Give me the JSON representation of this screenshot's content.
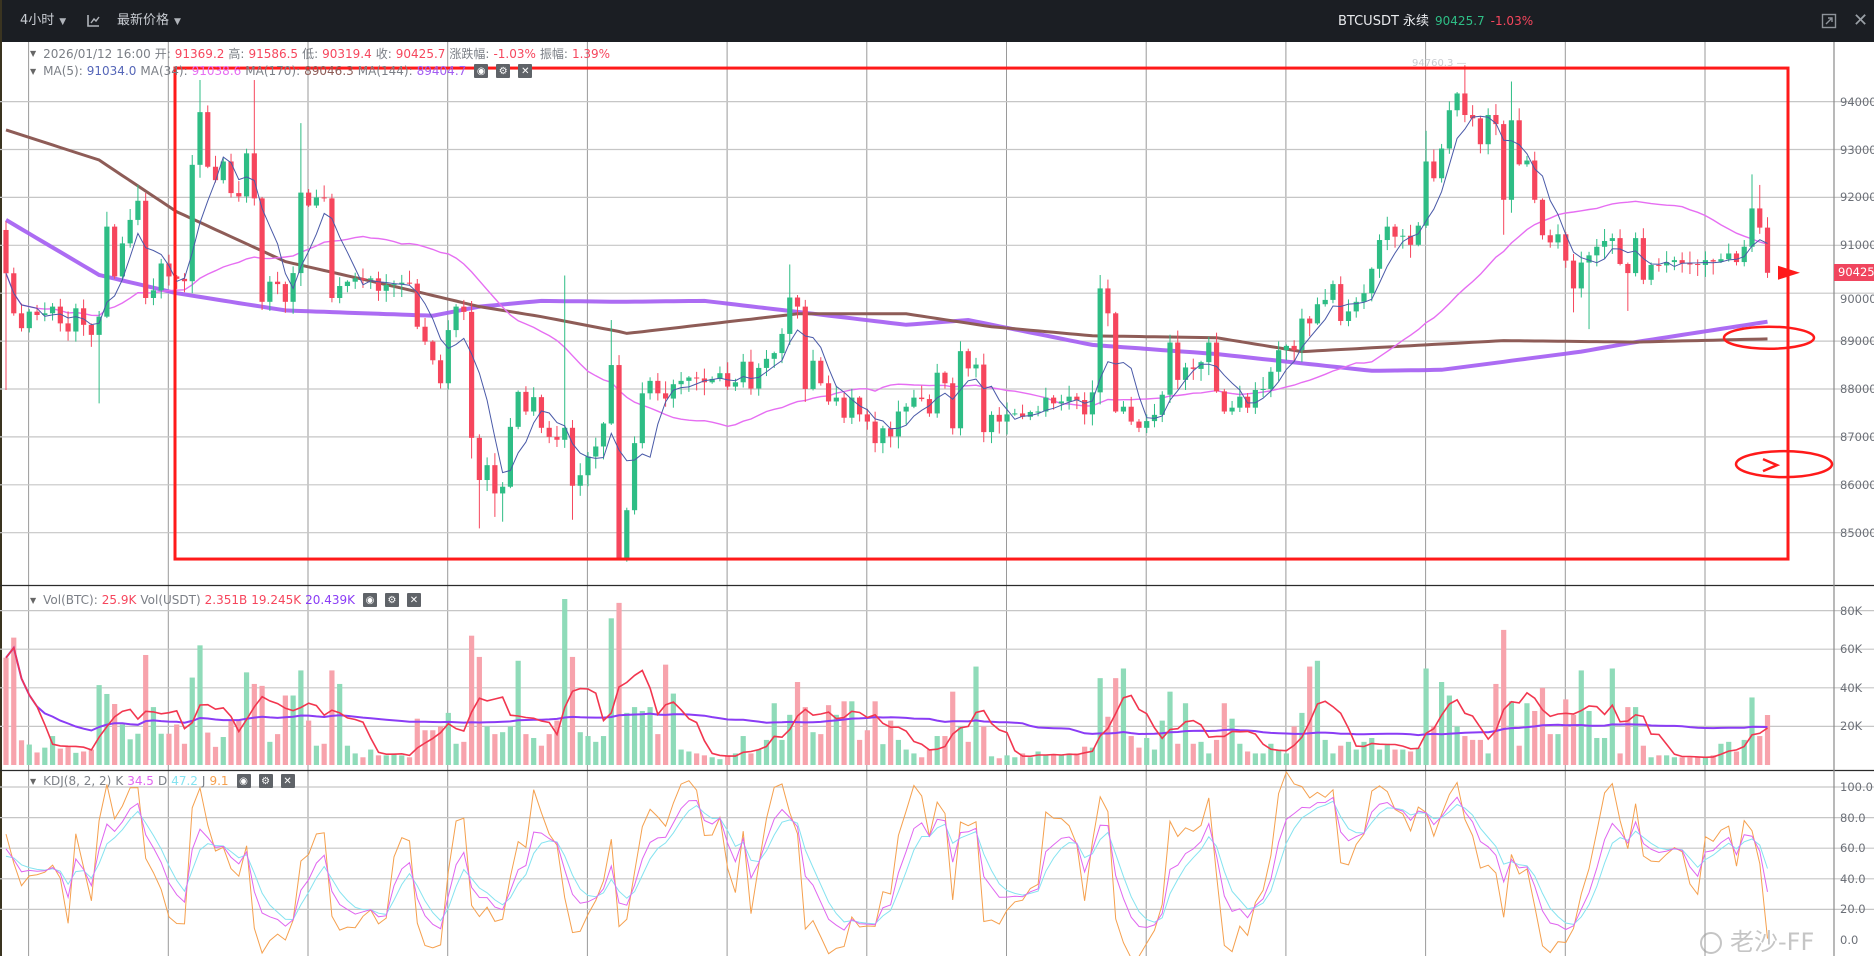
{
  "toolbar": {
    "interval": "4小时",
    "chart_type_icon": "candlestick-icon",
    "price_type": "最新价格"
  },
  "ticker": {
    "symbol": "BTCUSDT 永续",
    "price": "90425.7",
    "change": "-1.03%"
  },
  "window_icons": [
    "restore-icon",
    "close-icon"
  ],
  "ohlc_legend": {
    "datetime": "2026/01/12 16:00",
    "open_label": "开:",
    "open": "91369.2",
    "high_label": "高:",
    "high": "91586.5",
    "low_label": "低:",
    "low": "90319.4",
    "close_label": "收:",
    "close": "90425.7",
    "change_label": "涨跌幅:",
    "change": "-1.03%",
    "amp_label": "振幅:",
    "amp": "1.39%"
  },
  "ma_legend": [
    {
      "label": "MA(5):",
      "value": "91034.0",
      "color": "#5566b8"
    },
    {
      "label": "MA(34):",
      "value": "91038.6",
      "color": "#e66ef2"
    },
    {
      "label": "MA(170):",
      "value": "89046.3",
      "color": "#8e5c57"
    },
    {
      "label": "MA(144):",
      "value": "89404.7",
      "color": "#a35cf2"
    }
  ],
  "vol_legend": {
    "label1": "Vol(BTC):",
    "vol_btc": "25.9K",
    "label2": "Vol(USDT)",
    "vol_usdt": "2.351B",
    "ma1": "19.245K",
    "ma2": "20.439K"
  },
  "kdj_legend": {
    "label": "KDJ(8, 2, 2)",
    "k_label": "K",
    "k": "34.5",
    "d_label": "D",
    "d": "47.2",
    "j_label": "J",
    "j": "9.1"
  },
  "high_marker": "94760.3",
  "current_price_tag": "90425.7",
  "watermark": "老沙-FF",
  "colors": {
    "up": "#2ebd85",
    "down": "#f6465d",
    "up_vol": "#8fdbb9",
    "down_vol": "#f7a3ac",
    "annotation": "#ff1a1a",
    "ma5": "#4a5aa8",
    "ma34": "#e66ef2",
    "ma170": "#8e5c57",
    "ma144": "#a35cf2",
    "vol_ma5": "#f2364f",
    "vol_ma60": "#8a3cf5",
    "k": "#e066f0",
    "d": "#85e3f0",
    "j": "#f5a04e"
  },
  "chart_data": {
    "type": "candlestick",
    "interval": "4h",
    "price_axis": {
      "ticks": [
        94000,
        93000,
        92000,
        91000,
        90000,
        89000,
        88000,
        87000,
        86000,
        85000
      ],
      "labels": [
        "94000.0",
        "93000.0",
        "92000.0",
        "91000.0",
        "90000.0",
        "89000.0",
        "88000.0",
        "87000.0",
        "86000.0",
        "85000.0"
      ]
    },
    "volume_axis": {
      "ticks": [
        80,
        60,
        40,
        20
      ],
      "labels": [
        "80K",
        "60K",
        "40K",
        "20K"
      ]
    },
    "kdj_axis": {
      "ticks": [
        100,
        80,
        60,
        40,
        20,
        0
      ],
      "labels": [
        "100.0",
        "80.0",
        "60.0",
        "40.0",
        "20.0",
        "0.0"
      ]
    },
    "first_open": 91320,
    "closes": [
      90416,
      89580,
      89270,
      89615,
      89545,
      89580,
      89720,
      89370,
      89200,
      89685,
      89340,
      89130,
      89510,
      91390,
      90350,
      91040,
      91530,
      91930,
      89900,
      90060,
      90620,
      90350,
      90300,
      90250,
      92680,
      93780,
      92640,
      92360,
      92750,
      92090,
      92020,
      92920,
      91980,
      89820,
      90240,
      90190,
      89820,
      90420,
      92100,
      91830,
      92000,
      91980,
      89900,
      90150,
      90240,
      90310,
      90280,
      90310,
      90050,
      90170,
      90190,
      90220,
      90200,
      89300,
      88990,
      88600,
      88120,
      89230,
      89720,
      89610,
      86980,
      86100,
      86410,
      85820,
      85960,
      87210,
      87940,
      87530,
      87830,
      87190,
      87000,
      86940,
      87190,
      85980,
      86200,
      86590,
      86800,
      87280,
      88500,
      84465,
      85470,
      86870,
      87910,
      88170,
      87910,
      87800,
      88100,
      88170,
      88240,
      88220,
      88140,
      88210,
      88330,
      88050,
      88140,
      88570,
      88010,
      88440,
      88630,
      88750,
      89150,
      89910,
      89720,
      88000,
      88590,
      88120,
      87740,
      87820,
      87400,
      87820,
      87470,
      87320,
      86870,
      87180,
      87010,
      87530,
      87630,
      87820,
      87790,
      87490,
      88340,
      88120,
      87180,
      88790,
      88430,
      88510,
      87100,
      87460,
      87320,
      87470,
      87490,
      87420,
      87520,
      87530,
      87820,
      87700,
      87740,
      87840,
      87770,
      87470,
      87930,
      90100,
      89580,
      87530,
      87630,
      87320,
      87190,
      87330,
      87460,
      87880,
      88970,
      88190,
      88450,
      88420,
      88560,
      88970,
      87950,
      87530,
      87610,
      87840,
      87610,
      87980,
      88000,
      88360,
      88810,
      88900,
      88810,
      89470,
      89370,
      89770,
      89860,
      90190,
      89420,
      89620,
      89820,
      90000,
      90510,
      91110,
      91390,
      91180,
      91200,
      91010,
      91410,
      92750,
      92400,
      93020,
      93820,
      94170,
      93720,
      93650,
      93110,
      93720,
      93530,
      91950,
      93610,
      92690,
      92770,
      91950,
      91210,
      91060,
      91230,
      90680,
      90100,
      90640,
      90790,
      90970,
      91090,
      91150,
      90610,
      90420,
      91150,
      90280,
      90590,
      90580,
      90650,
      90690,
      90620,
      90610,
      90590,
      90690,
      90660,
      90710,
      90830,
      90650,
      90970,
      91770,
      91369.2,
      90425.7
    ],
    "high_overrides": {
      "0": 91500,
      "13": 91700,
      "17": 92260,
      "25": 94450,
      "32": 94450,
      "38": 93550,
      "72": 90370,
      "78": 89440,
      "101": 90600,
      "141": 90380,
      "183": 93390,
      "188": 94760.3,
      "194": 94420,
      "225": 92480,
      "226": 92260,
      "227": 91586.5
    },
    "low_overrides": {
      "0": 87980,
      "12": 87700,
      "60": 86550,
      "61": 85090,
      "63": 85330,
      "64": 85230,
      "73": 85270,
      "79": 84465,
      "193": 91220,
      "202": 89600,
      "204": 89250,
      "209": 89630,
      "227": 90319.4
    },
    "volumes_k": [
      55.6,
      66,
      12.8,
      10.6,
      6.5,
      9,
      15,
      8.5,
      9.4,
      6.3,
      7,
      8,
      41.4,
      36.8,
      31.6,
      21,
      13.3,
      16.2,
      57,
      30,
      16.2,
      16.2,
      21,
      11,
      45.3,
      62,
      16.8,
      9.4,
      14.5,
      23,
      23,
      48,
      42,
      41,
      12,
      16,
      36,
      36,
      49,
      23,
      10,
      11,
      49,
      42,
      10,
      6,
      4,
      8,
      5,
      5,
      6,
      5,
      4,
      24,
      18,
      18,
      20,
      27,
      11,
      12,
      67,
      56,
      20,
      16,
      17,
      20,
      54,
      16,
      14,
      10,
      16,
      23,
      86,
      56,
      17,
      15,
      12,
      15,
      76,
      84,
      27,
      30,
      28,
      30,
      16,
      52,
      37,
      8,
      7,
      6,
      5,
      4,
      3,
      5,
      6,
      15,
      6,
      8,
      13,
      32,
      13,
      26,
      43,
      30,
      17,
      16,
      31,
      26,
      33,
      33,
      13,
      18,
      33,
      10.8,
      23,
      13,
      8,
      6,
      4,
      8,
      15,
      15,
      38,
      20,
      12,
      51,
      20,
      4.5,
      3.5,
      5,
      4,
      6,
      4,
      7,
      5,
      5,
      5,
      6,
      6,
      9.5,
      9,
      45,
      25,
      45,
      50,
      15,
      9,
      14,
      8,
      23,
      38,
      11,
      32,
      11,
      12,
      6,
      13,
      32,
      24,
      11,
      7,
      6,
      6,
      11,
      8,
      6,
      20,
      27,
      51,
      54,
      13,
      6,
      10,
      12,
      8,
      12,
      14,
      8,
      11,
      8,
      8,
      7,
      9,
      50,
      20,
      43,
      36,
      20,
      15,
      13,
      13,
      6,
      42,
      70,
      33,
      10,
      32,
      28,
      40,
      16,
      16,
      34,
      26,
      49,
      28,
      14,
      14,
      50,
      6,
      30,
      30,
      10,
      4,
      5,
      5,
      4,
      4,
      4,
      4,
      4,
      5,
      11,
      12,
      7,
      13,
      35,
      15,
      25.9
    ],
    "ma170_keypoints": [
      [
        0,
        93410
      ],
      [
        12,
        92780
      ],
      [
        22,
        91700
      ],
      [
        36,
        90660
      ],
      [
        53,
        90030
      ],
      [
        61,
        89720
      ],
      [
        69,
        89510
      ],
      [
        79,
        89200
      ],
      [
        80,
        89160
      ],
      [
        102,
        89570
      ],
      [
        116,
        89570
      ],
      [
        127,
        89300
      ],
      [
        140,
        89110
      ],
      [
        156,
        89070
      ],
      [
        167,
        88780
      ],
      [
        193,
        89010
      ],
      [
        210,
        88980
      ],
      [
        227,
        89046.3
      ]
    ],
    "ma144_keypoints": [
      [
        0,
        91530
      ],
      [
        12,
        90380
      ],
      [
        22,
        90000
      ],
      [
        36,
        89640
      ],
      [
        48,
        89570
      ],
      [
        55,
        89530
      ],
      [
        61,
        89720
      ],
      [
        69,
        89840
      ],
      [
        79,
        89820
      ],
      [
        90,
        89840
      ],
      [
        102,
        89610
      ],
      [
        116,
        89340
      ],
      [
        124,
        89440
      ],
      [
        140,
        88920
      ],
      [
        156,
        88730
      ],
      [
        176,
        88380
      ],
      [
        185,
        88400
      ],
      [
        203,
        88780
      ],
      [
        210,
        88980
      ],
      [
        227,
        89404.7
      ]
    ],
    "annotations": {
      "box_price_range": [
        84450,
        94700
      ],
      "resistance_line": 90425.7,
      "support_line": 86410,
      "ellipse_prices": [
        89050,
        86410
      ]
    }
  }
}
